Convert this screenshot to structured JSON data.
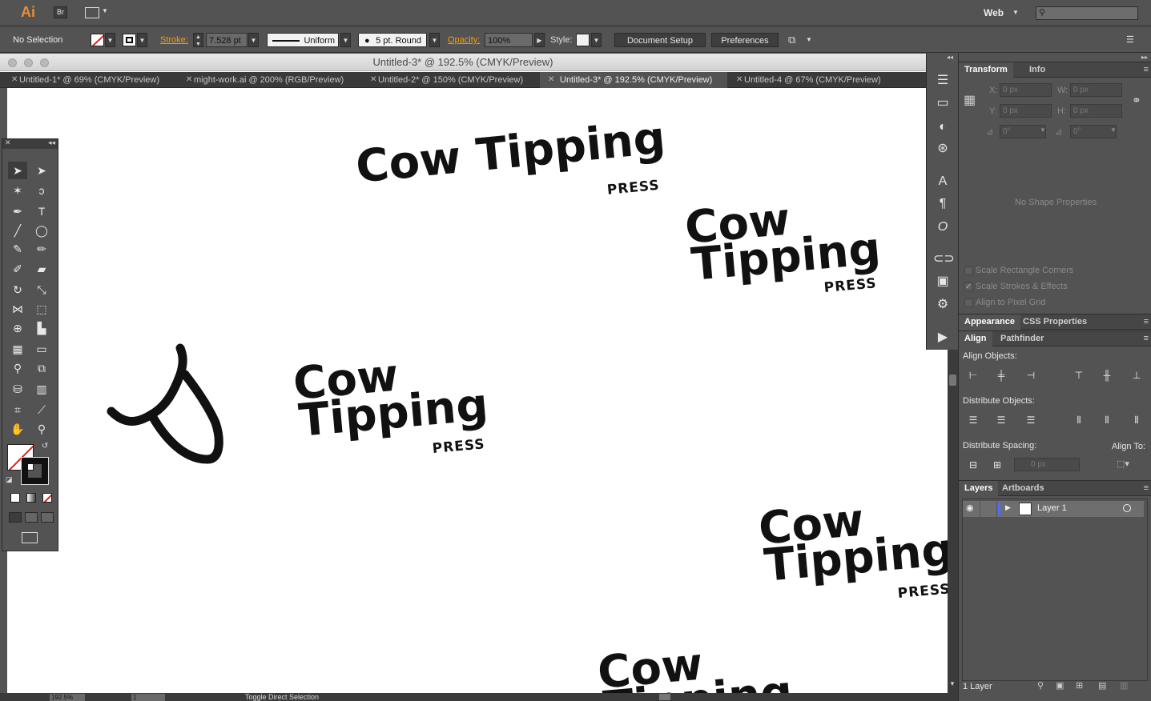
{
  "appbar": {
    "app_logo": "Ai",
    "bridge_label": "Br",
    "workspace": "Web",
    "search_placeholder": ""
  },
  "control": {
    "selection": "No Selection",
    "stroke_label": "Stroke:",
    "stroke_value": "7.528 pt",
    "profile": "Uniform",
    "brush": "5 pt. Round",
    "opacity_label": "Opacity:",
    "opacity_value": "100%",
    "style_label": "Style:",
    "document_setup": "Document Setup",
    "preferences": "Preferences"
  },
  "window": {
    "title": "Untitled-3* @ 192.5% (CMYK/Preview)"
  },
  "tabs": [
    {
      "label": "Untitled-1* @ 69% (CMYK/Preview)"
    },
    {
      "label": "might-work.ai @ 200% (RGB/Preview)"
    },
    {
      "label": "Untitled-2* @ 150% (CMYK/Preview)"
    },
    {
      "label": "Untitled-3* @ 192.5% (CMYK/Preview)"
    },
    {
      "label": "Untitled-4 @ 67% (CMYK/Preview)"
    }
  ],
  "artwork": {
    "word1": "Cow",
    "word2": "Tipping",
    "cow_tipping": "Cow Tipping",
    "press": "PRESS"
  },
  "transform": {
    "tab1": "Transform",
    "tab2": "Info",
    "x_label": "X:",
    "y_label": "Y:",
    "w_label": "W:",
    "h_label": "H:",
    "x": "0 px",
    "y": "0 px",
    "w": "0 px",
    "h": "0 px",
    "angle": "0°",
    "shear": "0°",
    "no_shape": "No Shape Properties",
    "scale_corners": "Scale Rectangle Corners",
    "scale_strokes": "Scale Strokes & Effects",
    "align_pixel": "Align to Pixel Grid"
  },
  "appearance": {
    "tab1": "Appearance",
    "tab2": "CSS Properties"
  },
  "align": {
    "tab1": "Align",
    "tab2": "Pathfinder",
    "align_objects": "Align Objects:",
    "distribute_objects": "Distribute Objects:",
    "distribute_spacing": "Distribute Spacing:",
    "align_to": "Align To:",
    "spacing_value": "0 px"
  },
  "layers": {
    "tab1": "Layers",
    "tab2": "Artboards",
    "layer_name": "Layer 1",
    "count": "1 Layer"
  },
  "status": {
    "zoom": "192.5%",
    "page": "1",
    "tool_hint": "Toggle Direct Selection"
  }
}
